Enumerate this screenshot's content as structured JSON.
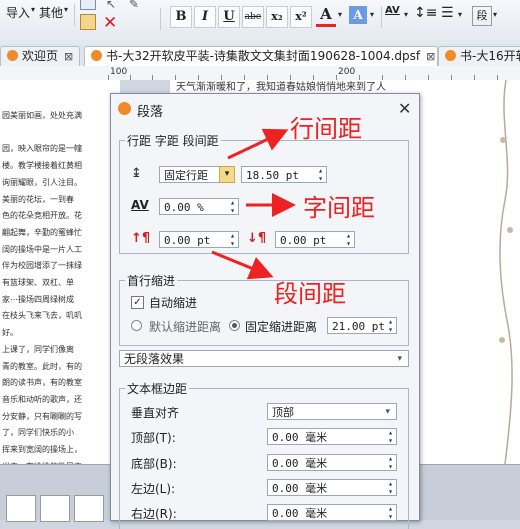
{
  "toolbar": {
    "import_label": "导入",
    "other_label": "其他",
    "format_buttons": [
      "B",
      "I",
      "U",
      "abe",
      "x₂",
      "x²"
    ],
    "fontcolor_letter": "A",
    "highlight_letter": "A",
    "spacing_glyph": "AV",
    "zoom_glyph": "段"
  },
  "tabs": [
    {
      "label": "欢迎页"
    },
    {
      "label": "书-大32开软皮平装-诗集散文文集封面190628-1004.dpsf"
    },
    {
      "label": "书-大16开软"
    }
  ],
  "ruler": {
    "marks": [
      "100",
      "200"
    ]
  },
  "document": {
    "top_line": "天气渐渐暖和了，我知道春姑娘悄悄地来到了人",
    "left_lines": [
      "园美丽如画，处处充满",
      "",
      "园，映入眼帘的是一幢",
      "楼。教学楼接着红黄相",
      "询丽耀眼，引人注目。",
      "美丽的花坛，一到春",
      "色的花朵竞相开放。花",
      "翩起舞，辛勤的蜜蜂忙",
      "阔的操场中是一片人工",
      "伴为校园增添了一抹绿",
      "有篮球架、双杠、单",
      "家⋯操场四周绿树成",
      "在枝头飞来飞去，叽叽",
      "好。",
      "上课了，同学们像离",
      "青的教室。此时，有的",
      "朗的读书声，有的教室",
      "音乐和动听的歌声，还",
      "分安静，只有唰唰的写",
      "了，同学们快乐的小",
      "挥来到宽阔的操场上，",
      "光中，在徐徐的微风中",
      "游戏、打篮球、捧跤。"
    ]
  },
  "dialog": {
    "title": "段落",
    "close_glyph": "✕",
    "group_spacing": {
      "label": "行距 字距 段间距",
      "line_spacing_type": "固定行距",
      "line_spacing_value": "18.50 pt",
      "char_spacing_value": "0.00 %",
      "para_before_value": "0.00 pt",
      "para_after_value": "0.00 pt"
    },
    "group_indent": {
      "label": "首行缩进",
      "auto_indent_label": "自动缩进",
      "auto_indent_checked": true,
      "default_distance_label": "默认缩进距离",
      "fixed_distance_label": "固定缩进距离",
      "fixed_distance_value": "21.00 pt",
      "selected": "fixed"
    },
    "effect": {
      "value": "无段落效果"
    },
    "group_frame": {
      "label": "文本框边距",
      "valign_label": "垂直对齐",
      "valign_value": "顶部",
      "top_label": "顶部(T):",
      "top_value": "0.00 毫米",
      "bottom_label": "底部(B):",
      "bottom_value": "0.00 毫米",
      "left_label": "左边(L):",
      "left_value": "0.00 毫米",
      "right_label": "右边(R):",
      "right_value": "0.00 毫米"
    }
  },
  "annotations": {
    "line_spacing": "行间距",
    "char_spacing": "字间距",
    "para_spacing": "段间距"
  },
  "colors": {
    "annotation": "#e22222",
    "accent": "#f08a2a"
  }
}
